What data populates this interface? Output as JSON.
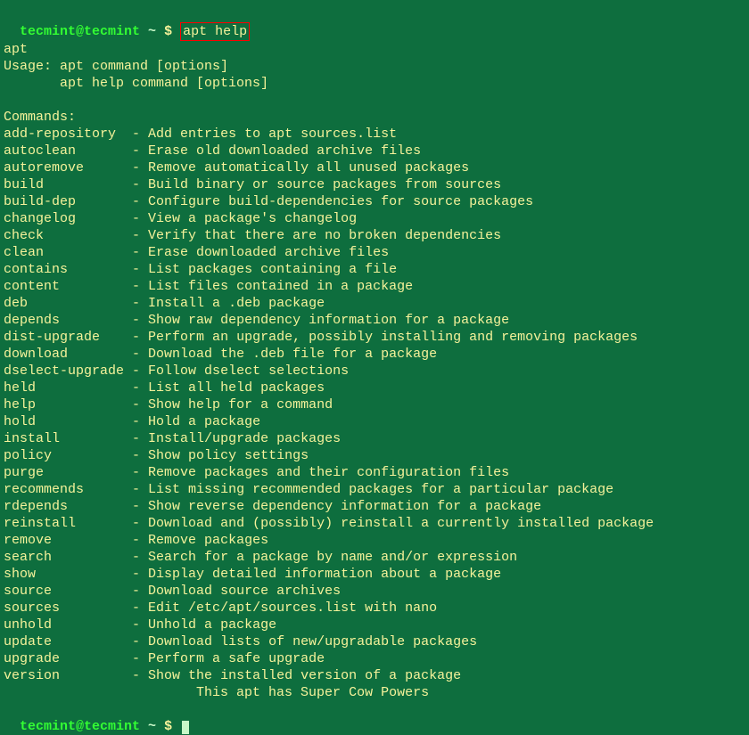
{
  "prompt": {
    "user": "tecmint@tecmint",
    "tilde": " ~ ",
    "dollar": "$ ",
    "command": "apt help"
  },
  "output_header": {
    "line1": "apt",
    "line2": "Usage: apt command [options]",
    "line3": "       apt help command [options]"
  },
  "commands_header": "Commands:",
  "commands": [
    {
      "name": "add-repository ",
      "desc": "- Add entries to apt sources.list"
    },
    {
      "name": "autoclean      ",
      "desc": "- Erase old downloaded archive files"
    },
    {
      "name": "autoremove     ",
      "desc": "- Remove automatically all unused packages"
    },
    {
      "name": "build          ",
      "desc": "- Build binary or source packages from sources"
    },
    {
      "name": "build-dep      ",
      "desc": "- Configure build-dependencies for source packages"
    },
    {
      "name": "changelog      ",
      "desc": "- View a package's changelog"
    },
    {
      "name": "check          ",
      "desc": "- Verify that there are no broken dependencies"
    },
    {
      "name": "clean          ",
      "desc": "- Erase downloaded archive files"
    },
    {
      "name": "contains       ",
      "desc": "- List packages containing a file"
    },
    {
      "name": "content        ",
      "desc": "- List files contained in a package"
    },
    {
      "name": "deb            ",
      "desc": "- Install a .deb package"
    },
    {
      "name": "depends        ",
      "desc": "- Show raw dependency information for a package"
    },
    {
      "name": "dist-upgrade   ",
      "desc": "- Perform an upgrade, possibly installing and removing packages"
    },
    {
      "name": "download       ",
      "desc": "- Download the .deb file for a package"
    },
    {
      "name": "dselect-upgrade",
      "desc": "- Follow dselect selections"
    },
    {
      "name": "held           ",
      "desc": "- List all held packages"
    },
    {
      "name": "help           ",
      "desc": "- Show help for a command"
    },
    {
      "name": "hold           ",
      "desc": "- Hold a package"
    },
    {
      "name": "install        ",
      "desc": "- Install/upgrade packages"
    },
    {
      "name": "policy         ",
      "desc": "- Show policy settings"
    },
    {
      "name": "purge          ",
      "desc": "- Remove packages and their configuration files"
    },
    {
      "name": "recommends     ",
      "desc": "- List missing recommended packages for a particular package"
    },
    {
      "name": "rdepends       ",
      "desc": "- Show reverse dependency information for a package"
    },
    {
      "name": "reinstall      ",
      "desc": "- Download and (possibly) reinstall a currently installed package"
    },
    {
      "name": "remove         ",
      "desc": "- Remove packages"
    },
    {
      "name": "search         ",
      "desc": "- Search for a package by name and/or expression"
    },
    {
      "name": "show           ",
      "desc": "- Display detailed information about a package"
    },
    {
      "name": "source         ",
      "desc": "- Download source archives"
    },
    {
      "name": "sources        ",
      "desc": "- Edit /etc/apt/sources.list with nano"
    },
    {
      "name": "unhold         ",
      "desc": "- Unhold a package"
    },
    {
      "name": "update         ",
      "desc": "- Download lists of new/upgradable packages"
    },
    {
      "name": "upgrade        ",
      "desc": "- Perform a safe upgrade"
    },
    {
      "name": "version        ",
      "desc": "- Show the installed version of a package"
    }
  ],
  "footer_line": "                        This apt has Super Cow Powers",
  "prompt2": {
    "user": "tecmint@tecmint",
    "tilde": " ~ ",
    "dollar": "$ "
  }
}
